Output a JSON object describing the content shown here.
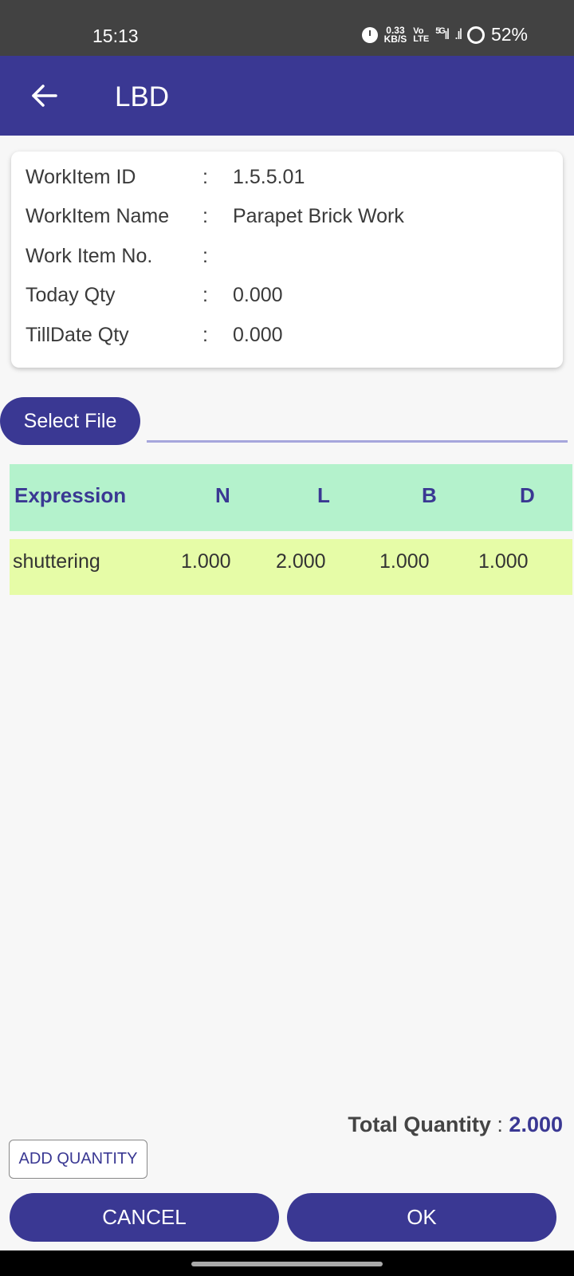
{
  "status_bar": {
    "time": "15:13",
    "speed_value": "0.33",
    "speed_unit": "KB/S",
    "volte_top": "Vo",
    "volte_bottom": "LTE",
    "network": "5G",
    "signal_1": "ıl",
    "signal_2": ".ıl",
    "battery": "52%",
    "icons": [
      "alarm-icon",
      "signal-icon",
      "battery-icon"
    ]
  },
  "app_bar": {
    "title": "LBD",
    "back_icon": "arrow-left-icon",
    "color": "#3a3893"
  },
  "info_card": {
    "rows": [
      {
        "label": "WorkItem ID",
        "colon": ":",
        "value": "1.5.5.01"
      },
      {
        "label": "WorkItem Name",
        "colon": ":",
        "value": "Parapet Brick Work"
      },
      {
        "label": "Work Item No.",
        "colon": ":",
        "value": ""
      },
      {
        "label": "Today Qty",
        "colon": ":",
        "value": "0.000"
      },
      {
        "label": "TillDate Qty",
        "colon": ":",
        "value": "0.000"
      }
    ]
  },
  "file_picker": {
    "button_label": "Select File",
    "file_name": ""
  },
  "table": {
    "header_color": "#b4f2cc",
    "row_color": "#e6fca7",
    "columns": [
      "Expression",
      "N",
      "L",
      "B",
      "D"
    ],
    "rows": [
      [
        "shuttering",
        "1.000",
        "2.000",
        "1.000",
        "1.000"
      ]
    ]
  },
  "total": {
    "label": "Total Quantity",
    "colon": " : ",
    "value": "2.000"
  },
  "actions": {
    "add_quantity": "ADD QUANTITY",
    "cancel": "CANCEL",
    "ok": "OK"
  }
}
